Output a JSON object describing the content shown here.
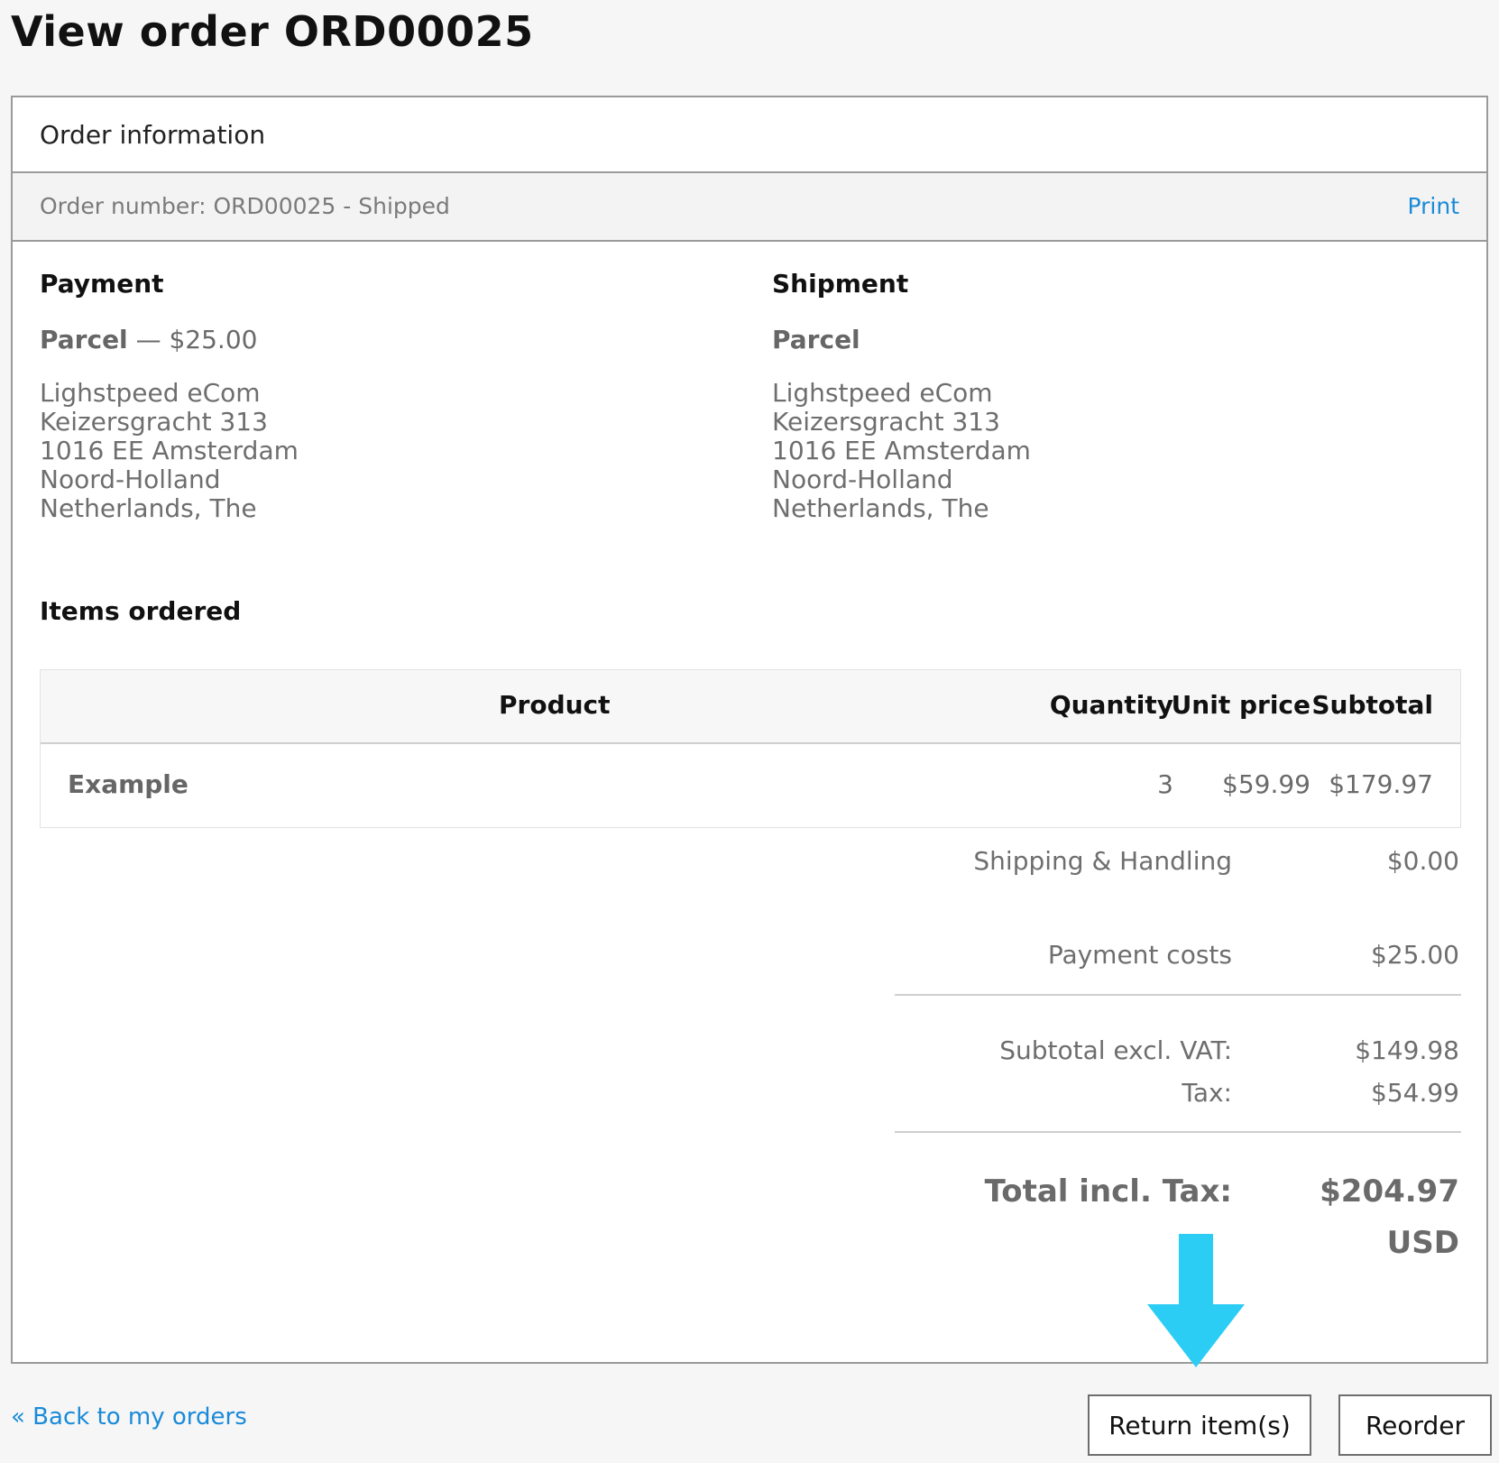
{
  "page": {
    "title": "View order ORD00025"
  },
  "panel": {
    "header": "Order information",
    "order_number": "Order number: ORD00025 - Shipped",
    "print_label": "Print"
  },
  "payment": {
    "heading": "Payment",
    "method": "Parcel",
    "separator": " — ",
    "amount": "$25.00",
    "address": [
      "Lighstpeed eCom",
      "Keizersgracht 313",
      "1016 EE Amsterdam",
      "Noord-Holland",
      "Netherlands, The"
    ]
  },
  "shipment": {
    "heading": "Shipment",
    "method": "Parcel",
    "address": [
      "Lighstpeed eCom",
      "Keizersgracht 313",
      "1016 EE Amsterdam",
      "Noord-Holland",
      "Netherlands, The"
    ]
  },
  "items": {
    "heading": "Items ordered",
    "columns": [
      "Product",
      "Quantity",
      "Unit price",
      "Subtotal"
    ],
    "rows": [
      {
        "product": "Example",
        "quantity": "3",
        "unit_price": "$59.99",
        "subtotal": "$179.97"
      }
    ]
  },
  "totals": {
    "shipping_label": "Shipping & Handling",
    "shipping_value": "$0.00",
    "payment_label": "Payment costs",
    "payment_value": "$25.00",
    "subtotal_label": "Subtotal excl. VAT:",
    "subtotal_value": "$149.98",
    "tax_label": "Tax:",
    "tax_value": "$54.99",
    "total_label": "Total incl. Tax:",
    "total_value": "$204.97",
    "currency": "USD"
  },
  "footer": {
    "back_label": "« Back to my orders",
    "return_label": "Return item(s)",
    "reorder_label": "Reorder"
  },
  "colors": {
    "link": "#1a8ad8",
    "arrow": "#2bcdf5"
  },
  "icons": {
    "arrow": "arrow-down-icon"
  }
}
